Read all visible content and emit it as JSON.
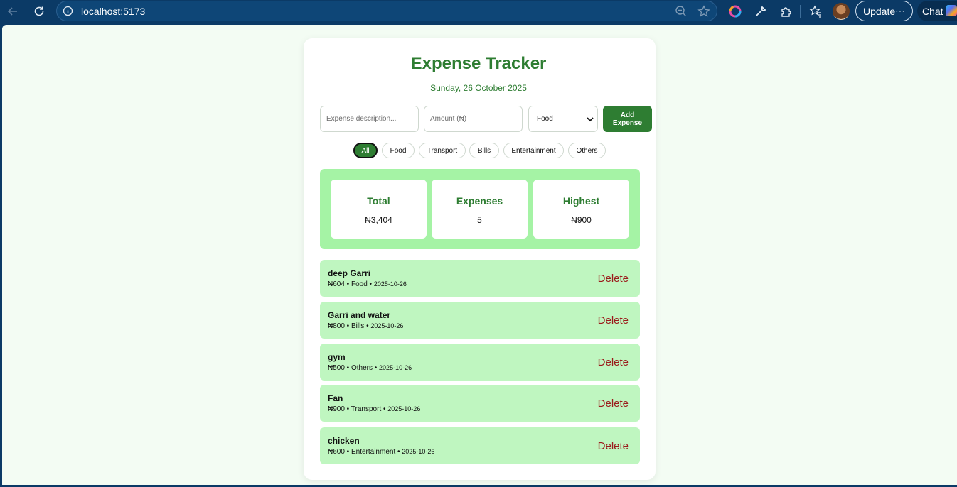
{
  "browser": {
    "url": "localhost:5173",
    "update_label": "Update",
    "update_more": "⋯",
    "chat_label": "Chat"
  },
  "app": {
    "title": "Expense Tracker",
    "date": "Sunday, 26 October 2025",
    "accent_color": "#2e7d32"
  },
  "form": {
    "description_placeholder": "Expense description...",
    "amount_placeholder": "Amount (₦)",
    "category_selected": "Food",
    "add_label_line1": "Add",
    "add_label_line2": "Expense"
  },
  "filters": [
    {
      "label": "All",
      "active": true
    },
    {
      "label": "Food"
    },
    {
      "label": "Transport"
    },
    {
      "label": "Bills"
    },
    {
      "label": "Entertainment"
    },
    {
      "label": "Others"
    }
  ],
  "stats": [
    {
      "label": "Total",
      "value": "₦3,404"
    },
    {
      "label": "Expenses",
      "value": "5"
    },
    {
      "label": "Highest",
      "value": "₦900"
    }
  ],
  "expenses": [
    {
      "name": "deep Garri",
      "amount": "₦604",
      "category": "Food",
      "date": "2025-10-26",
      "delete_label": "Delete"
    },
    {
      "name": "Garri and water",
      "amount": "₦800",
      "category": "Bills",
      "date": "2025-10-26",
      "delete_label": "Delete"
    },
    {
      "name": "gym",
      "amount": "₦500",
      "category": "Others",
      "date": "2025-10-26",
      "delete_label": "Delete"
    },
    {
      "name": "Fan",
      "amount": "₦900",
      "category": "Transport",
      "date": "2025-10-26",
      "delete_label": "Delete"
    },
    {
      "name": "chicken",
      "amount": "₦600",
      "category": "Entertainment",
      "date": "2025-10-26",
      "delete_label": "Delete"
    }
  ],
  "icons": {
    "back": "arrow-left-icon",
    "reload": "reload-icon",
    "info": "info-icon",
    "zoom": "zoom-out-icon",
    "favorite": "star-icon",
    "copilot": "copilot-icon",
    "dropper": "eyedropper-icon",
    "extensions": "puzzle-icon",
    "favorites": "favorites-icon"
  }
}
